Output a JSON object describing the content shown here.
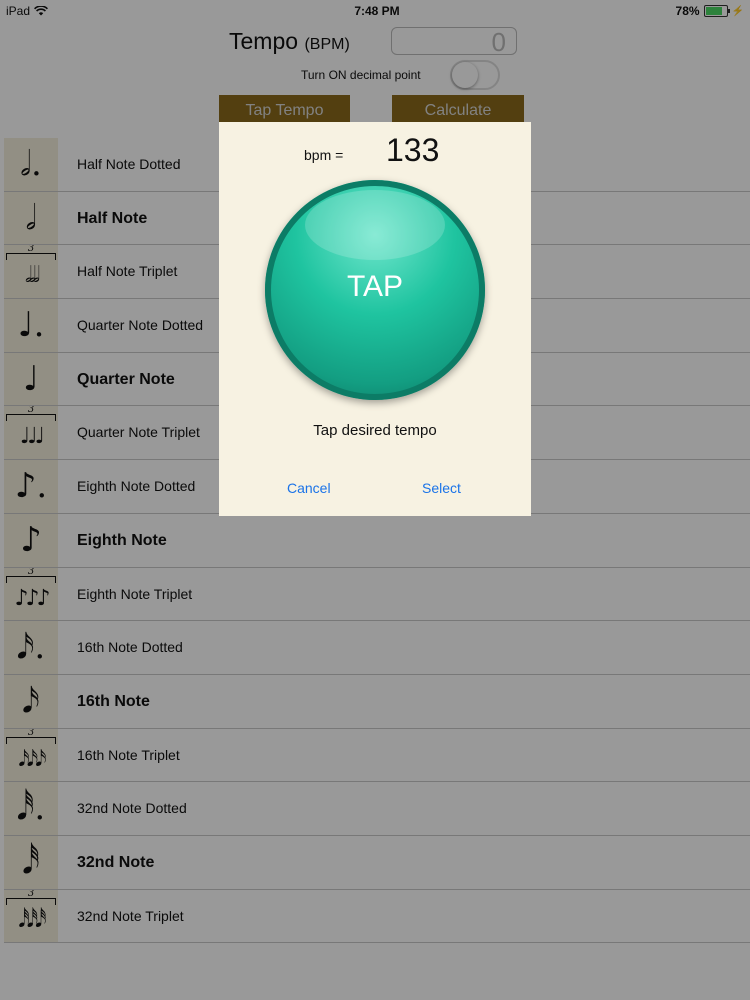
{
  "status_bar": {
    "device": "iPad",
    "time": "7:48 PM",
    "battery": "78%"
  },
  "header": {
    "tempo_label": "Tempo",
    "tempo_unit": "(BPM)",
    "tempo_value": "0",
    "decimal_label": "Turn ON decimal point",
    "tap_tempo_label": "Tap Tempo",
    "calculate_label": "Calculate"
  },
  "notes": [
    {
      "symbol": "𝅗𝅥.",
      "label": "Half Note Dotted",
      "bold": false,
      "triplet": false
    },
    {
      "symbol": "𝅗𝅥",
      "label": "Half Note",
      "bold": true,
      "triplet": false
    },
    {
      "symbol": "𝅗𝅥𝅗𝅥𝅗𝅥",
      "label": "Half Note Triplet",
      "bold": false,
      "triplet": true,
      "tuplet": "3"
    },
    {
      "symbol": "♩.",
      "label": "Quarter Note Dotted",
      "bold": false,
      "triplet": false
    },
    {
      "symbol": "♩",
      "label": "Quarter Note",
      "bold": true,
      "triplet": false
    },
    {
      "symbol": "♩♩♩",
      "label": "Quarter Note Triplet",
      "bold": false,
      "triplet": true,
      "tuplet": "3"
    },
    {
      "symbol": "♪.",
      "label": "Eighth Note Dotted",
      "bold": false,
      "triplet": false
    },
    {
      "symbol": "♪",
      "label": "Eighth Note",
      "bold": true,
      "triplet": false
    },
    {
      "symbol": "♪♪♪",
      "label": "Eighth Note Triplet",
      "bold": false,
      "triplet": true,
      "tuplet": "3"
    },
    {
      "symbol": "𝅘𝅥𝅯.",
      "label": "16th Note Dotted",
      "bold": false,
      "triplet": false
    },
    {
      "symbol": "𝅘𝅥𝅯",
      "label": "16th Note",
      "bold": true,
      "triplet": false
    },
    {
      "symbol": "𝅘𝅥𝅯𝅘𝅥𝅯𝅘𝅥𝅯",
      "label": "16th Note Triplet",
      "bold": false,
      "triplet": true,
      "tuplet": "3"
    },
    {
      "symbol": "𝅘𝅥𝅰.",
      "label": "32nd Note Dotted",
      "bold": false,
      "triplet": false
    },
    {
      "symbol": "𝅘𝅥𝅰",
      "label": "32nd Note",
      "bold": true,
      "triplet": false
    },
    {
      "symbol": "𝅘𝅥𝅰𝅘𝅥𝅰𝅘𝅥𝅰",
      "label": "32nd Note Triplet",
      "bold": false,
      "triplet": true,
      "tuplet": "3"
    }
  ],
  "modal": {
    "bpm_label": "bpm =",
    "bpm_value": "133",
    "tap_label": "TAP",
    "hint": "Tap desired tempo",
    "cancel_label": "Cancel",
    "select_label": "Select"
  },
  "colors": {
    "accent": "#1a73e8",
    "tap_button": "#1fc4a0",
    "tool_button": "#8a6a1c",
    "note_cell_bg": "#f3eedc",
    "modal_bg": "#f7f2e2"
  }
}
